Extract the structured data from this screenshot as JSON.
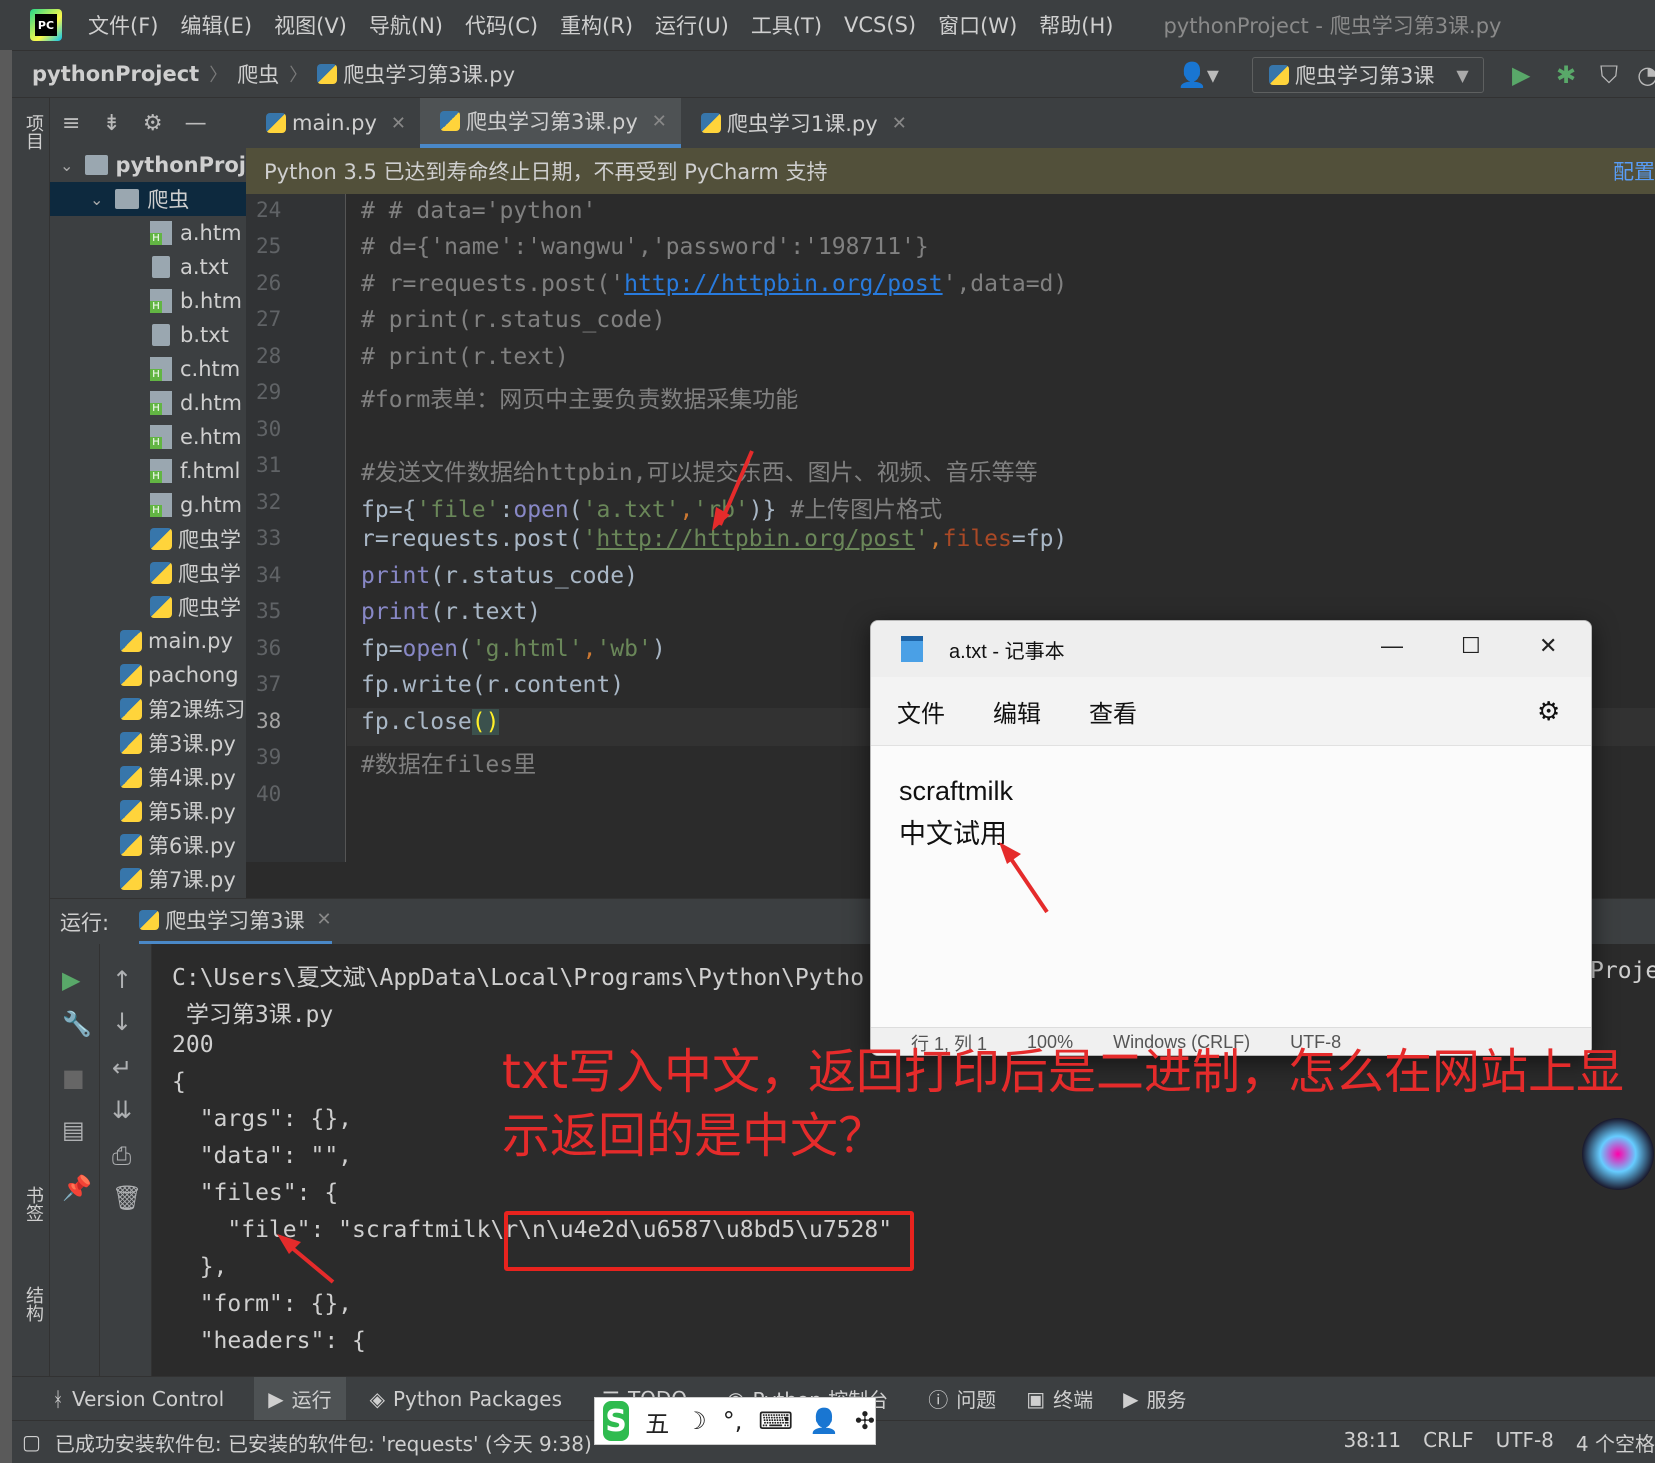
{
  "menubar": {
    "items": [
      "文件(F)",
      "编辑(E)",
      "视图(V)",
      "导航(N)",
      "代码(C)",
      "重构(R)",
      "运行(U)",
      "工具(T)",
      "VCS(S)",
      "窗口(W)",
      "帮助(H)"
    ],
    "window_title": "pythonProject - 爬虫学习第3课.py"
  },
  "navbar": {
    "project": "pythonProject",
    "folder": "爬虫",
    "file": "爬虫学习第3课.py",
    "run_config": "爬虫学习第3课"
  },
  "left_stripe": {
    "project_label": "项目",
    "bookmarks_label": "书签",
    "structure_label": "结构"
  },
  "tree": {
    "root": "pythonProj",
    "folder": "爬虫",
    "files": [
      "a.htm",
      "a.txt",
      "b.htm",
      "b.txt",
      "c.htm",
      "d.htm",
      "e.htm",
      "f.html",
      "g.htm",
      "爬虫学",
      "爬虫学",
      "爬虫学"
    ],
    "root_files": [
      "main.py",
      "pachong",
      "第2课练习",
      "第3课.py",
      "第4课.py",
      "第5课.py",
      "第6课.py",
      "第7课.py"
    ]
  },
  "tabs": [
    {
      "label": "main.py"
    },
    {
      "label": "爬虫学习第3课.py"
    },
    {
      "label": "爬虫学习1课.py"
    }
  ],
  "banner": {
    "text": "Python 3.5 已达到寿命终止日期，不再受到 PyCharm 支持",
    "link": "配置"
  },
  "editor": {
    "line_numbers": [
      "24",
      "25",
      "26",
      "27",
      "28",
      "29",
      "30",
      "31",
      "32",
      "33",
      "34",
      "35",
      "36",
      "37",
      "38",
      "39",
      "40"
    ],
    "lines": {
      "l24": "# # data='python'",
      "l25": "# d={'name':'wangwu','password':'198711'}",
      "l26a": "# r=requests.post('",
      "l26b": "http://httpbin.org/post",
      "l26c": "',data=d)",
      "l27": "# print(r.status_code)",
      "l28": "# print(r.text)",
      "l29": "#form表单：网页中主要负责数据采集功能",
      "l31": "#发送文件数据给httpbin,可以提交东西、图片、视频、音乐等等",
      "l32a": "fp={",
      "l32b": "'file'",
      "l32c": ":",
      "l32d": "open",
      "l32e": "(",
      "l32f": "'a.txt'",
      "l32g": ",",
      "l32h": "'rb'",
      "l32i": ")} ",
      "l32j": "#上传图片格式",
      "l33a": "r=requests.post(",
      "l33b": "'",
      "l33c": "http://httpbin.org/post",
      "l33d": "'",
      "l33e": ",",
      "l33f": "files",
      "l33g": "=fp)",
      "l34a": "print",
      "l34b": "(r.status_code)",
      "l35a": "print",
      "l35b": "(r.text)",
      "l36a": "fp=",
      "l36b": "open",
      "l36c": "(",
      "l36d": "'g.html'",
      "l36e": ",",
      "l36f": "'wb'",
      "l36g": ")",
      "l37a": "fp.write(r.content)",
      "l38a": "fp.close",
      "l38b": "()",
      "l39": "#数据在files里"
    }
  },
  "run_panel": {
    "label": "运行:",
    "tab": "爬虫学习第3课",
    "console": [
      "C:\\Users\\夏文斌\\AppData\\Local\\Programs\\Python\\Pytho",
      " 学习第3课.py",
      "200",
      "{",
      "  \"args\": {},",
      "  \"data\": \"\",",
      "  \"files\": {",
      "    \"file\": \"scraftmilk\\r\\n\\u4e2d\\u6587\\u8bd5\\u7528\"",
      "  },",
      "  \"form\": {},",
      "  \"headers\": {"
    ],
    "console_tail": "Proje"
  },
  "toolwindows": [
    "Version Control",
    "运行",
    "Python Packages",
    "TODO",
    "Python 控制台",
    "问题",
    "终端",
    "服务"
  ],
  "statusbar": {
    "message": "已成功安装软件包: 已安装的软件包: 'requests' (今天 9:38)",
    "position": "38:11",
    "line_sep": "CRLF",
    "encoding": "UTF-8",
    "indent": "4 个空格"
  },
  "ime": {
    "logo": "S",
    "mode": "五"
  },
  "notepad": {
    "title": "a.txt - 记事本",
    "menu": [
      "文件",
      "编辑",
      "查看"
    ],
    "content_line1": "scraftmilk",
    "content_line2": "中文试用",
    "status_items": [
      "行 1, 列 1",
      "100%",
      "Windows (CRLF)",
      "UTF-8"
    ]
  },
  "annotation": {
    "text": "txt写入中文，返回打印后是二进制，怎么在网站上显示返回的是中文？"
  },
  "colors": {
    "annotation": "#e52b2b",
    "editor_bg": "#2b2b2b",
    "panel_bg": "#3c3f41",
    "accent": "#4a88c7"
  }
}
